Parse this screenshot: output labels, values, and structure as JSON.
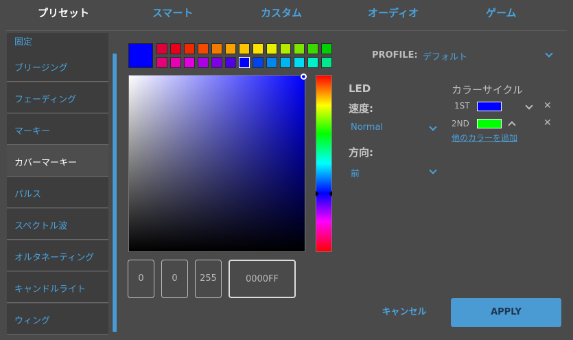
{
  "tabs": [
    {
      "label": "プリセット"
    },
    {
      "label": "スマート"
    },
    {
      "label": "カスタム"
    },
    {
      "label": "オーディオ"
    },
    {
      "label": "ゲーム"
    }
  ],
  "sidebar": {
    "items": [
      {
        "label": "固定"
      },
      {
        "label": "ブリージング"
      },
      {
        "label": "フェーディング"
      },
      {
        "label": "マーキー"
      },
      {
        "label": "カバーマーキー"
      },
      {
        "label": "パルス"
      },
      {
        "label": "スペクトル波"
      },
      {
        "label": "オルタネーティング"
      },
      {
        "label": "キャンドルライト"
      },
      {
        "label": "ウィング"
      }
    ],
    "active": "カバーマーキー"
  },
  "picker": {
    "current_color": "#0000FF",
    "swatches_row1": [
      "#e2003a",
      "#e8001c",
      "#ef2a00",
      "#f24a00",
      "#f57a00",
      "#f7a400",
      "#f9c600",
      "#fbe200",
      "#e8f000",
      "#b4ec00",
      "#7de300",
      "#3cd900",
      "#00d000"
    ],
    "swatches_row2": [
      "#e6007a",
      "#e800b4",
      "#e000e0",
      "#aa00e6",
      "#7d00e6",
      "#5000e6",
      "#0000ff",
      "#0044ee",
      "#0088f0",
      "#00b6f0",
      "#00ddf2",
      "#00f0c8",
      "#00e88c"
    ],
    "r": "0",
    "g": "0",
    "b": "255",
    "hex": "0000FF"
  },
  "profile": {
    "label": "PROFILE:",
    "value": "デフォルト"
  },
  "led": {
    "title": "LED",
    "speed_label": "速度:",
    "speed_value": "Normal",
    "direction_label": "方向:",
    "direction_value": "前"
  },
  "color_cycle": {
    "title": "カラーサイクル",
    "entries": [
      {
        "label": "1ST",
        "color": "#0000ff"
      },
      {
        "label": "2ND",
        "color": "#00ff00"
      }
    ],
    "add_link": "他のカラーを追加"
  },
  "buttons": {
    "cancel": "キャンセル",
    "apply": "APPLY"
  }
}
